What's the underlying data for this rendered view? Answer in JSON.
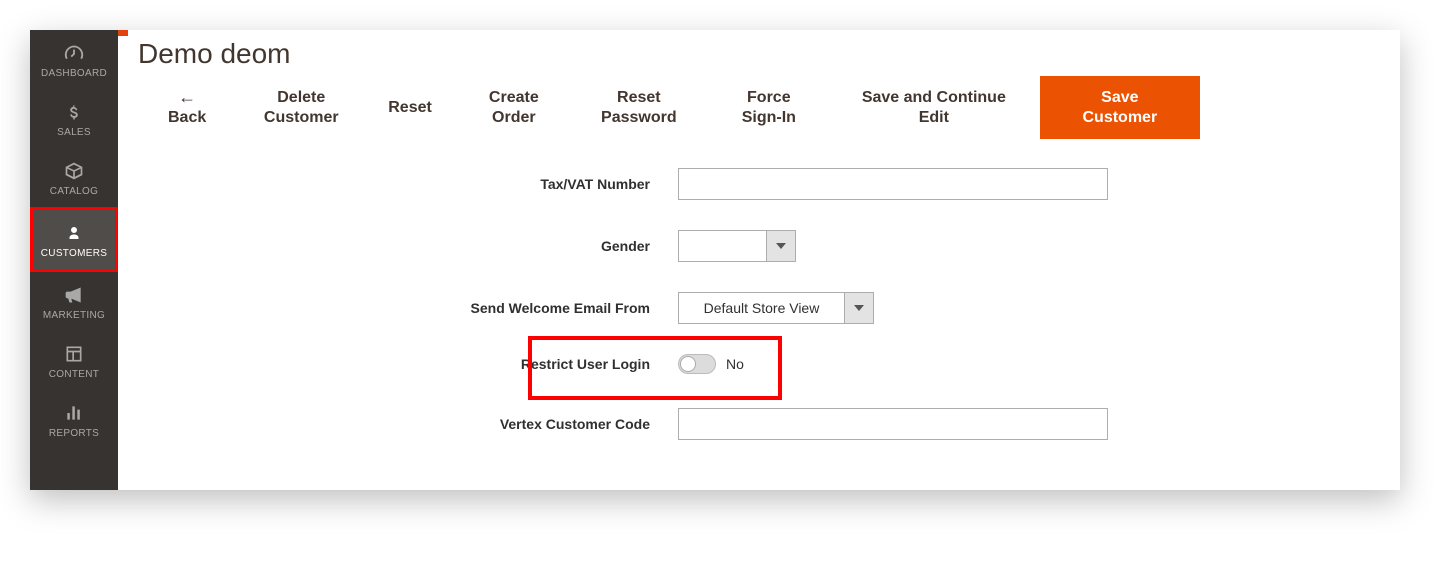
{
  "sidebar": {
    "dashboard": "DASHBOARD",
    "sales": "SALES",
    "catalog": "CATALOG",
    "customers": "CUSTOMERS",
    "marketing": "MARKETING",
    "content": "CONTENT",
    "reports": "REPORTS"
  },
  "page": {
    "title": "Demo deom"
  },
  "toolbar": {
    "back": "Back",
    "delete": "Delete Customer",
    "reset": "Reset",
    "create_order": "Create Order",
    "reset_password": "Reset Password",
    "force_signin": "Force Sign-In",
    "save_continue": "Save and Continue Edit",
    "save": "Save Customer"
  },
  "form": {
    "tax_vat": {
      "label": "Tax/VAT Number",
      "value": ""
    },
    "gender": {
      "label": "Gender",
      "value": ""
    },
    "welcome_email": {
      "label": "Send Welcome Email From",
      "value": "Default Store View"
    },
    "restrict_login": {
      "label": "Restrict User Login",
      "value": "No"
    },
    "vertex_code": {
      "label": "Vertex Customer Code",
      "value": ""
    }
  }
}
